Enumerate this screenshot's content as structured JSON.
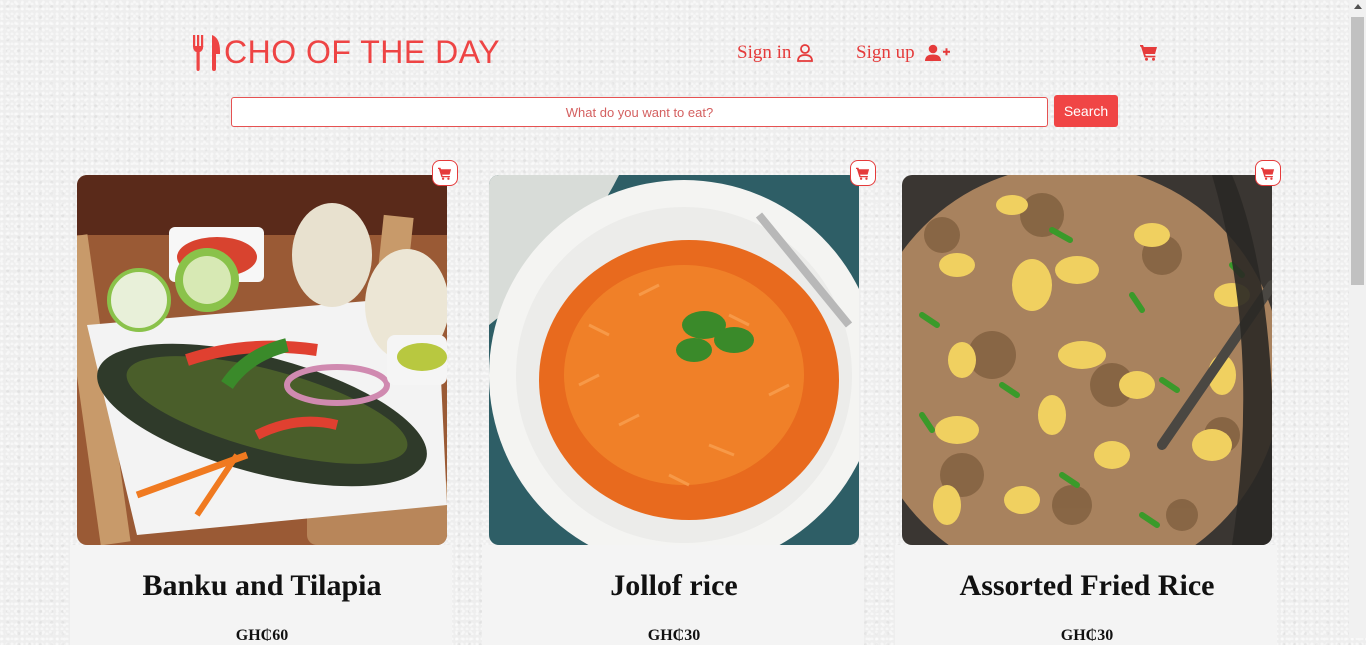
{
  "brand": {
    "name": "CHO OF THE DAY",
    "icon": "fork-knife-icon",
    "color": "#ee4444"
  },
  "nav": {
    "signin_label": "Sign in",
    "signin_icon": "user-icon",
    "signup_label": "Sign up",
    "signup_icon": "user-plus-icon",
    "cart_icon": "cart-icon"
  },
  "search": {
    "placeholder": "What do you want to eat?",
    "value": "",
    "button_label": "Search"
  },
  "products": [
    {
      "title": "Banku and Tilapia",
      "price": "GH₵60",
      "image": "grilled fish with banku"
    },
    {
      "title": "Jollof rice",
      "price": "GH₵30",
      "image": "plate of jollof rice"
    },
    {
      "title": "Assorted Fried Rice",
      "price": "GH₵30",
      "image": "fried rice with egg"
    }
  ],
  "colors": {
    "accent": "#ee4444",
    "button": "#f04545"
  }
}
